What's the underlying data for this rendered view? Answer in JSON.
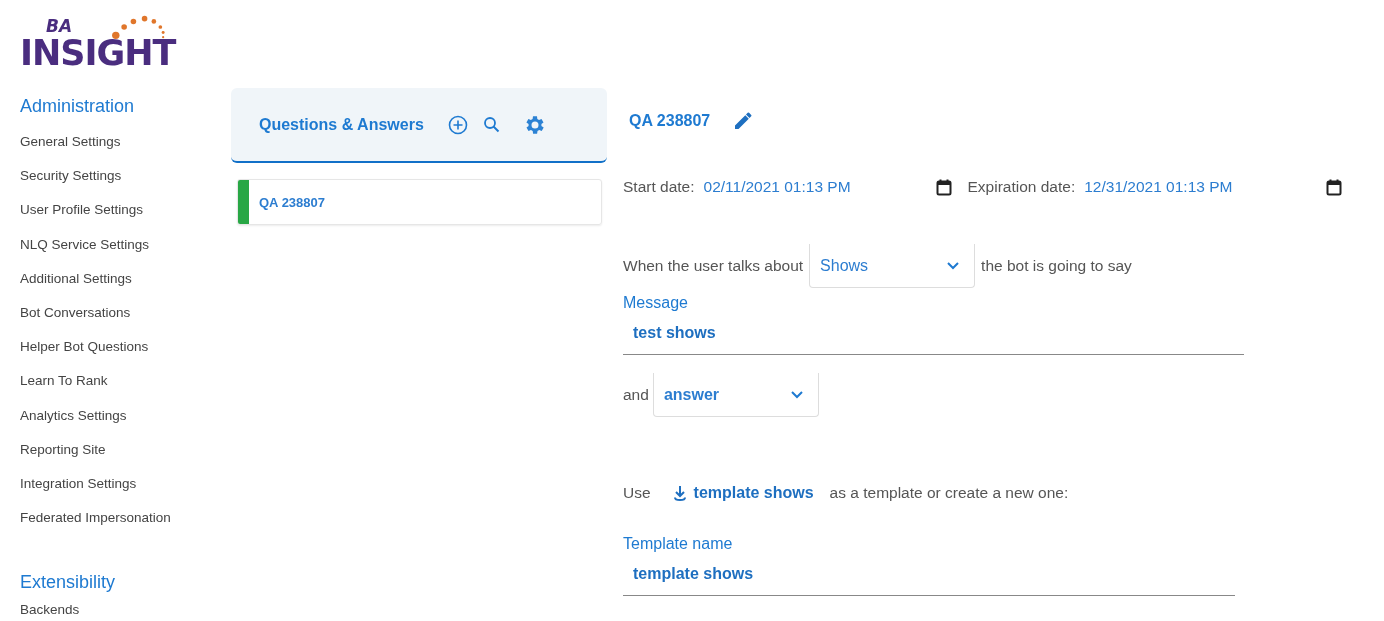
{
  "logo": {
    "small": "BA",
    "large": "INSIGHT"
  },
  "sidebar": {
    "sections": [
      {
        "title": "Administration",
        "items": [
          "General Settings",
          "Security Settings",
          "User Profile Settings",
          "NLQ Service Settings",
          "Additional Settings",
          "Bot Conversations",
          "Helper Bot Questions",
          "Learn To Rank",
          "Analytics Settings",
          "Reporting Site",
          "Integration Settings",
          "Federated Impersonation"
        ]
      },
      {
        "title": "Extensibility",
        "items": [
          "Backends"
        ]
      }
    ]
  },
  "qa_panel": {
    "title": "Questions & Answers",
    "items": [
      {
        "label": "QA 238807",
        "color": "#28a745"
      }
    ]
  },
  "detail": {
    "title": "QA 238807",
    "start_label": "Start date:",
    "start_value": "02/11/2021 01:13 PM",
    "expiration_label": "Expiration date:",
    "expiration_value": "12/31/2021 01:13 PM",
    "topic_prefix": "When the user talks about",
    "topic_value": "Shows",
    "topic_suffix": "the bot is going to say",
    "message_label": "Message",
    "message_value": "test shows",
    "and_label": "and",
    "type_value": "answer",
    "use_label": "Use",
    "template_link": "template shows",
    "use_suffix": "as a template or create a new one:",
    "template_label": "Template name",
    "template_value": "template shows"
  }
}
